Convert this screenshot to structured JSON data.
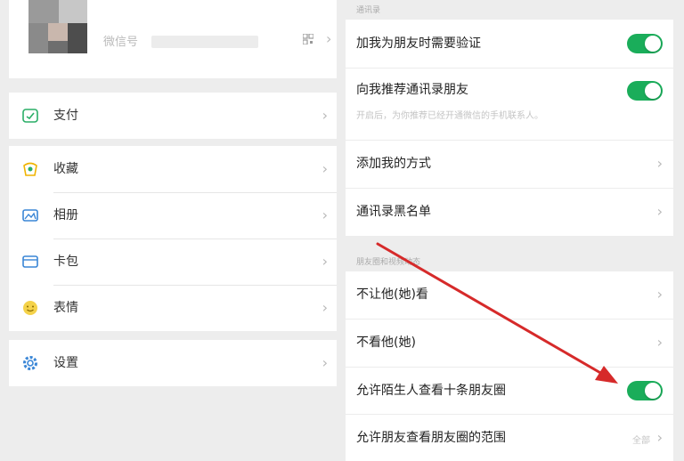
{
  "left_panel": {
    "profile": {
      "wechat_id_prefix": "微信号"
    },
    "menu_groups": [
      [
        {
          "label": "支付",
          "icon": "pay-icon"
        }
      ],
      [
        {
          "label": "收藏",
          "icon": "favorites-icon"
        },
        {
          "label": "相册",
          "icon": "album-icon"
        },
        {
          "label": "卡包",
          "icon": "cards-icon"
        },
        {
          "label": "表情",
          "icon": "stickers-icon"
        }
      ],
      [
        {
          "label": "设置",
          "icon": "settings-icon"
        }
      ]
    ]
  },
  "right_panel": {
    "section_contacts": "通讯录",
    "items_a": [
      {
        "title": "加我为朋友时需要验证",
        "toggle_on": true
      },
      {
        "title": "向我推荐通讯录朋友",
        "subtitle": "开启后，为你推荐已经开通微信的手机联系人。",
        "toggle_on": true
      },
      {
        "title": "添加我的方式"
      },
      {
        "title": "通讯录黑名单"
      }
    ],
    "section_moments": "朋友圈和视频动态",
    "items_b": [
      {
        "title": "不让他(她)看"
      },
      {
        "title": "不看他(她)"
      },
      {
        "title": "允许陌生人查看十条朋友圈",
        "toggle_on": true
      },
      {
        "title": "允许朋友查看朋友圈的范围",
        "value": "全部"
      }
    ]
  },
  "colors": {
    "toggle_green": "#1aad5a",
    "annotation_arrow": "#d62a2a",
    "icon_green": "#2aae67",
    "icon_yellow": "#f0b400"
  }
}
